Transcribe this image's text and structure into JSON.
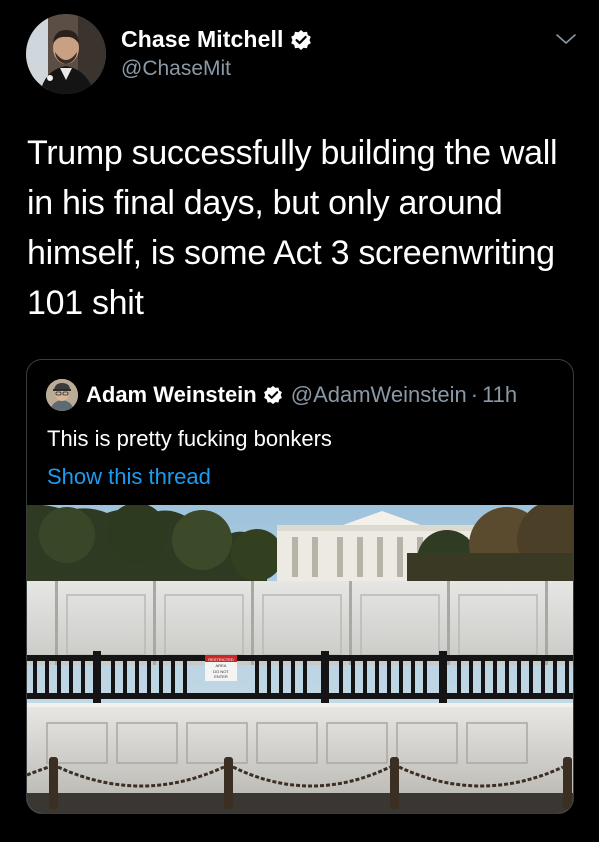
{
  "tweet": {
    "author_name": "Chase Mitchell",
    "author_handle": "@ChaseMit",
    "text": "Trump successfully building the wall in his final days, but only around himself, is some Act 3 screenwriting 101 shit",
    "icons": {
      "verified": "verified-badge-icon",
      "menu": "chevron-down-icon"
    }
  },
  "quote": {
    "author_name": "Adam Weinstein",
    "author_handle": "@AdamWeinstein",
    "separator": "·",
    "time": "11h",
    "text": "This is pretty fucking bonkers",
    "show_thread": "Show this thread",
    "photo": {
      "sign_line1": "RESTRICTED",
      "sign_line2": "AREA",
      "sign_line3": "DO NOT",
      "sign_line4": "ENTER"
    }
  },
  "colors": {
    "background": "#000000",
    "text": "#ffffff",
    "secondary": "#8b98a5",
    "link": "#1d9bf0",
    "border": "#3a3d40"
  }
}
